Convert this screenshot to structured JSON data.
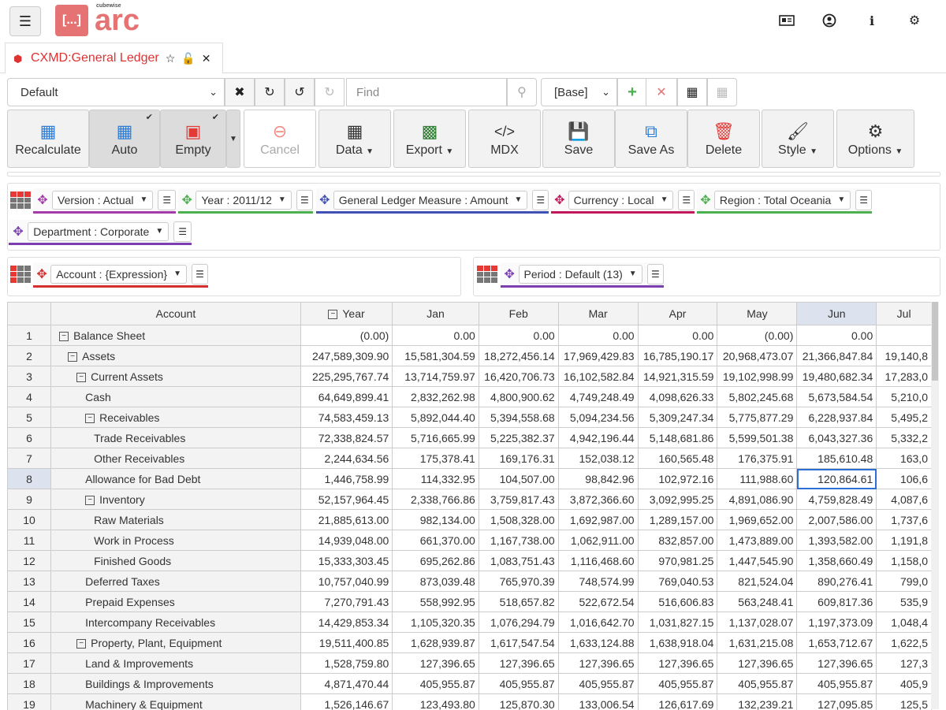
{
  "header": {
    "logo_box": "[...]",
    "logo_text": "arc",
    "logo_sub": "cubewise"
  },
  "tab": {
    "title": "CXMD:General Ledger"
  },
  "toolbar": {
    "view_select": "Default",
    "find_placeholder": "Find",
    "base_select": "[Base]"
  },
  "ribbon": {
    "recalculate": "Recalculate",
    "auto": "Auto",
    "empty": "Empty",
    "cancel": "Cancel",
    "data": "Data",
    "export": "Export",
    "mdx": "MDX",
    "save": "Save",
    "save_as": "Save As",
    "delete": "Delete",
    "style": "Style",
    "options": "Options"
  },
  "filters": [
    {
      "label": "Version : Actual",
      "color": "#a43ba8"
    },
    {
      "label": "Year : 2011/12",
      "color": "#4caf50"
    },
    {
      "label": "General Ledger Measure : Amount",
      "color": "#3f51b5"
    },
    {
      "label": "Currency : Local",
      "color": "#c2185b"
    },
    {
      "label": "Region : Total Oceania",
      "color": "#4caf50"
    },
    {
      "label": "Department : Corporate",
      "color": "#7b3fb0"
    }
  ],
  "rows_dim": {
    "label": "Account : {Expression}",
    "color": "#d32f2f"
  },
  "cols_dim": {
    "label": "Period : Default (13)",
    "color": "#7b3fb0"
  },
  "grid": {
    "account_header": "Account",
    "columns": [
      "Year",
      "Jan",
      "Feb",
      "Mar",
      "Apr",
      "May",
      "Jun",
      "Jul"
    ],
    "rows": [
      {
        "n": "1",
        "account": "Balance Sheet",
        "indent": 0,
        "toggle": true,
        "values": [
          "(0.00)",
          "0.00",
          "0.00",
          "0.00",
          "0.00",
          "(0.00)",
          "0.00",
          ""
        ]
      },
      {
        "n": "2",
        "account": "Assets",
        "indent": 1,
        "toggle": true,
        "values": [
          "247,589,309.90",
          "15,581,304.59",
          "18,272,456.14",
          "17,969,429.83",
          "16,785,190.17",
          "20,968,473.07",
          "21,366,847.84",
          "19,140,8"
        ]
      },
      {
        "n": "3",
        "account": "Current Assets",
        "indent": 2,
        "toggle": true,
        "values": [
          "225,295,767.74",
          "13,714,759.97",
          "16,420,706.73",
          "16,102,582.84",
          "14,921,315.59",
          "19,102,998.99",
          "19,480,682.34",
          "17,283,0"
        ]
      },
      {
        "n": "4",
        "account": "Cash",
        "indent": 3,
        "toggle": false,
        "values": [
          "64,649,899.41",
          "2,832,262.98",
          "4,800,900.62",
          "4,749,248.49",
          "4,098,626.33",
          "5,802,245.68",
          "5,673,584.54",
          "5,210,0"
        ]
      },
      {
        "n": "5",
        "account": "Receivables",
        "indent": 3,
        "toggle": true,
        "values": [
          "74,583,459.13",
          "5,892,044.40",
          "5,394,558.68",
          "5,094,234.56",
          "5,309,247.34",
          "5,775,877.29",
          "6,228,937.84",
          "5,495,2"
        ]
      },
      {
        "n": "6",
        "account": "Trade Receivables",
        "indent": 4,
        "toggle": false,
        "values": [
          "72,338,824.57",
          "5,716,665.99",
          "5,225,382.37",
          "4,942,196.44",
          "5,148,681.86",
          "5,599,501.38",
          "6,043,327.36",
          "5,332,2"
        ]
      },
      {
        "n": "7",
        "account": "Other Receivables",
        "indent": 4,
        "toggle": false,
        "values": [
          "2,244,634.56",
          "175,378.41",
          "169,176.31",
          "152,038.12",
          "160,565.48",
          "176,375.91",
          "185,610.48",
          "163,0"
        ]
      },
      {
        "n": "8",
        "account": "Allowance for Bad Debt",
        "indent": 3,
        "toggle": false,
        "values": [
          "1,446,758.99",
          "114,332.95",
          "104,507.00",
          "98,842.96",
          "102,972.16",
          "111,988.60",
          "120,864.61",
          "106,6"
        ]
      },
      {
        "n": "9",
        "account": "Inventory",
        "indent": 3,
        "toggle": true,
        "values": [
          "52,157,964.45",
          "2,338,766.86",
          "3,759,817.43",
          "3,872,366.60",
          "3,092,995.25",
          "4,891,086.90",
          "4,759,828.49",
          "4,087,6"
        ]
      },
      {
        "n": "10",
        "account": "Raw Materials",
        "indent": 4,
        "toggle": false,
        "values": [
          "21,885,613.00",
          "982,134.00",
          "1,508,328.00",
          "1,692,987.00",
          "1,289,157.00",
          "1,969,652.00",
          "2,007,586.00",
          "1,737,6"
        ]
      },
      {
        "n": "11",
        "account": "Work in Process",
        "indent": 4,
        "toggle": false,
        "values": [
          "14,939,048.00",
          "661,370.00",
          "1,167,738.00",
          "1,062,911.00",
          "832,857.00",
          "1,473,889.00",
          "1,393,582.00",
          "1,191,8"
        ]
      },
      {
        "n": "12",
        "account": "Finished Goods",
        "indent": 4,
        "toggle": false,
        "values": [
          "15,333,303.45",
          "695,262.86",
          "1,083,751.43",
          "1,116,468.60",
          "970,981.25",
          "1,447,545.90",
          "1,358,660.49",
          "1,158,0"
        ]
      },
      {
        "n": "13",
        "account": "Deferred Taxes",
        "indent": 3,
        "toggle": false,
        "values": [
          "10,757,040.99",
          "873,039.48",
          "765,970.39",
          "748,574.99",
          "769,040.53",
          "821,524.04",
          "890,276.41",
          "799,0"
        ]
      },
      {
        "n": "14",
        "account": "Prepaid Expenses",
        "indent": 3,
        "toggle": false,
        "values": [
          "7,270,791.43",
          "558,992.95",
          "518,657.82",
          "522,672.54",
          "516,606.83",
          "563,248.41",
          "609,817.36",
          "535,9"
        ]
      },
      {
        "n": "15",
        "account": "Intercompany Receivables",
        "indent": 3,
        "toggle": false,
        "values": [
          "14,429,853.34",
          "1,105,320.35",
          "1,076,294.79",
          "1,016,642.70",
          "1,031,827.15",
          "1,137,028.07",
          "1,197,373.09",
          "1,048,4"
        ]
      },
      {
        "n": "16",
        "account": "Property, Plant, Equipment",
        "indent": 2,
        "toggle": true,
        "values": [
          "19,511,400.85",
          "1,628,939.87",
          "1,617,547.54",
          "1,633,124.88",
          "1,638,918.04",
          "1,631,215.08",
          "1,653,712.67",
          "1,622,5"
        ]
      },
      {
        "n": "17",
        "account": "Land & Improvements",
        "indent": 3,
        "toggle": false,
        "values": [
          "1,528,759.80",
          "127,396.65",
          "127,396.65",
          "127,396.65",
          "127,396.65",
          "127,396.65",
          "127,396.65",
          "127,3"
        ]
      },
      {
        "n": "18",
        "account": "Buildings & Improvements",
        "indent": 3,
        "toggle": false,
        "values": [
          "4,871,470.44",
          "405,955.87",
          "405,955.87",
          "405,955.87",
          "405,955.87",
          "405,955.87",
          "405,955.87",
          "405,9"
        ]
      },
      {
        "n": "19",
        "account": "Machinery & Equipment",
        "indent": 3,
        "toggle": false,
        "values": [
          "1,526,146.67",
          "123,493.80",
          "125,870.30",
          "133,006.54",
          "126,617.69",
          "132,239.21",
          "127,095.85",
          "125,5"
        ]
      }
    ]
  }
}
